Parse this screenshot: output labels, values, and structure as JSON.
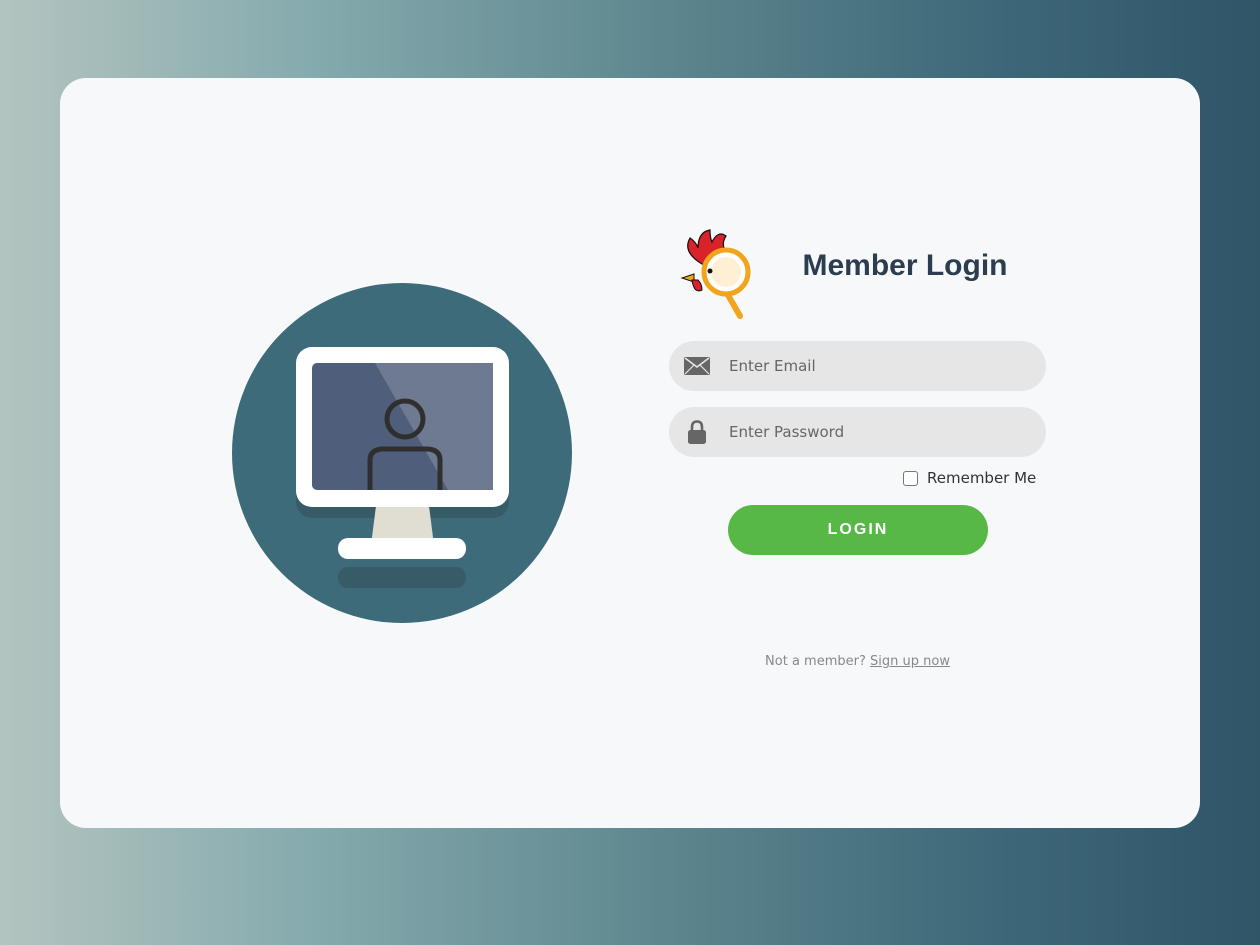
{
  "login": {
    "title": "Member Login",
    "email": {
      "placeholder": "Enter Email",
      "value": ""
    },
    "password": {
      "placeholder": "Enter Password",
      "value": ""
    },
    "remember_label": "Remember Me",
    "login_label": "LOGIN",
    "signup_prompt": "Not a member?",
    "signup_link": "Sign up now"
  },
  "icons": {
    "email": "envelope-icon",
    "password": "lock-icon",
    "logo": "rooster-magnifier-logo",
    "illustration": "computer-user-illustration"
  },
  "colors": {
    "login_button": "#57b846",
    "title": "#2b3d4f",
    "field_background": "#e6e6e6",
    "card_background": "#f7f8fa",
    "illustration_circle": "#3d6b7a"
  }
}
